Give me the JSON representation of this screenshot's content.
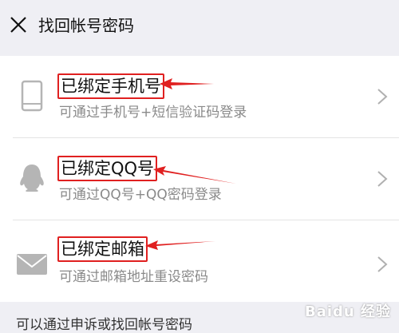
{
  "header": {
    "title": "找回帐号密码"
  },
  "options": [
    {
      "title": "已绑定手机号",
      "subtitle": "可通过手机号+短信验证码登录",
      "icon": "phone-icon"
    },
    {
      "title": "已绑定QQ号",
      "subtitle": "可通过QQ号+QQ密码登录",
      "icon": "qq-penguin-icon"
    },
    {
      "title": "已绑定邮箱",
      "subtitle": "可通过邮箱地址重设密码",
      "icon": "mail-envelope-icon"
    }
  ],
  "bottom": {
    "partial_text": "可以通过申诉或找回帐号密码"
  },
  "watermark": {
    "text": "Baidu 经验"
  },
  "colors": {
    "annotation": "#e02020",
    "background": "#efeff4",
    "subtitle": "#8a8a8a"
  }
}
